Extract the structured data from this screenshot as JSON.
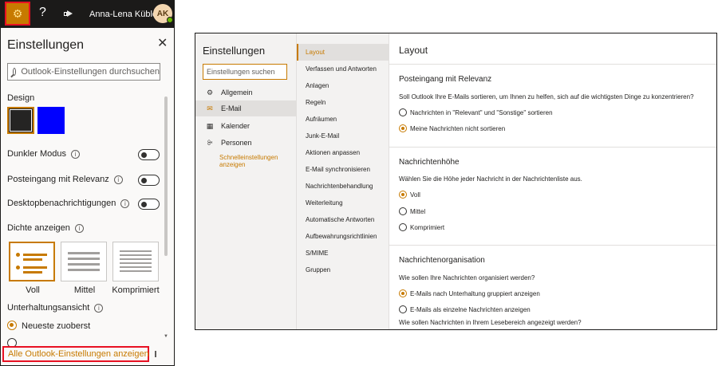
{
  "topbar": {
    "icons": [
      "gear-icon",
      "help-icon",
      "megaphone-icon"
    ],
    "help_glyph": "?",
    "user_name": "Anna-Lena Kübler",
    "avatar_initials": "AK",
    "accent": "#c77a00",
    "highlight": "#e81123"
  },
  "quick_panel": {
    "title": "Einstellungen",
    "search_placeholder": "Outlook-Einstellungen durchsuchen",
    "design_label": "Design",
    "theme_swatches": [
      {
        "name": "dark",
        "color": "#252423",
        "selected": true
      },
      {
        "name": "blue",
        "color": "#0000ff",
        "selected": false
      }
    ],
    "toggles": [
      {
        "label": "Dunkler Modus",
        "on": false
      },
      {
        "label": "Posteingang mit Relevanz",
        "on": false
      },
      {
        "label": "Desktopbenachrichtigungen",
        "on": false
      }
    ],
    "density_label": "Dichte anzeigen",
    "density_options": [
      {
        "label": "Voll",
        "selected": true
      },
      {
        "label": "Mittel",
        "selected": false
      },
      {
        "label": "Komprimiert",
        "selected": false
      }
    ],
    "conversation_label": "Unterhaltungsansicht",
    "conversation_option": "Neueste zuoberst",
    "all_settings_link": "Alle Outlook-Einstellungen anzeigen"
  },
  "settings_window": {
    "title": "Einstellungen",
    "search_placeholder": "Einstellungen suchen",
    "categories": [
      {
        "label": "Allgemein",
        "icon": "gear-icon",
        "selected": false
      },
      {
        "label": "E-Mail",
        "icon": "mail-icon",
        "selected": true
      },
      {
        "label": "Kalender",
        "icon": "calendar-icon",
        "selected": false
      },
      {
        "label": "Personen",
        "icon": "people-icon",
        "selected": false
      }
    ],
    "quick_settings_link": "Schnelleinstellungen anzeigen",
    "subcategories": [
      {
        "label": "Layout",
        "selected": true
      },
      {
        "label": "Verfassen und Antworten",
        "selected": false
      },
      {
        "label": "Anlagen",
        "selected": false
      },
      {
        "label": "Regeln",
        "selected": false
      },
      {
        "label": "Aufräumen",
        "selected": false
      },
      {
        "label": "Junk-E-Mail",
        "selected": false
      },
      {
        "label": "Aktionen anpassen",
        "selected": false
      },
      {
        "label": "E-Mail synchronisieren",
        "selected": false
      },
      {
        "label": "Nachrichtenbehandlung",
        "selected": false
      },
      {
        "label": "Weiterleitung",
        "selected": false
      },
      {
        "label": "Automatische Antworten",
        "selected": false
      },
      {
        "label": "Aufbewahrungsrichtlinien",
        "selected": false
      },
      {
        "label": "S/MIME",
        "selected": false
      },
      {
        "label": "Gruppen",
        "selected": false
      }
    ],
    "content": {
      "title": "Layout",
      "sections": [
        {
          "heading": "Posteingang mit Relevanz",
          "question": "Soll Outlook Ihre E-Mails sortieren, um Ihnen zu helfen, sich auf die wichtigsten Dinge zu konzentrieren?",
          "options": [
            {
              "label": "Nachrichten in \"Relevant\" und \"Sonstige\" sortieren",
              "selected": false
            },
            {
              "label": "Meine Nachrichten nicht sortieren",
              "selected": true
            }
          ]
        },
        {
          "heading": "Nachrichtenhöhe",
          "question": "Wählen Sie die Höhe jeder Nachricht in der Nachrichtenliste aus.",
          "options": [
            {
              "label": "Voll",
              "selected": true
            },
            {
              "label": "Mittel",
              "selected": false
            },
            {
              "label": "Komprimiert",
              "selected": false
            }
          ]
        },
        {
          "heading": "Nachrichtenorganisation",
          "question": "Wie sollen Ihre Nachrichten organisiert werden?",
          "options": [
            {
              "label": "E-Mails nach Unterhaltung gruppiert anzeigen",
              "selected": true
            },
            {
              "label": "E-Mails als einzelne Nachrichten anzeigen",
              "selected": false
            }
          ],
          "extra_question": "Wie sollen Nachrichten in Ihrem Lesebereich angezeigt werden?"
        }
      ]
    }
  }
}
